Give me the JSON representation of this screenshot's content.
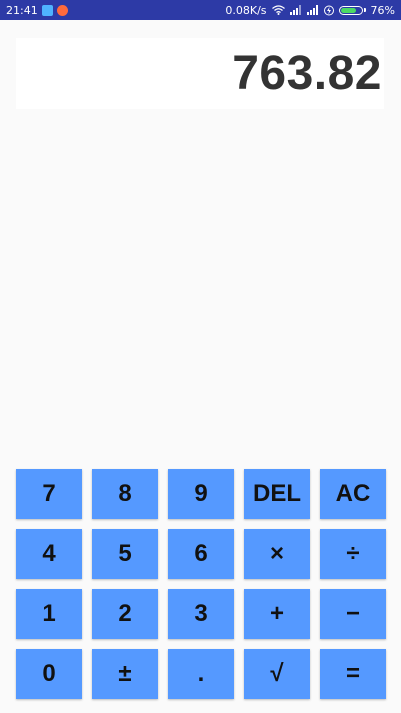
{
  "status_bar": {
    "time": "21:41",
    "network_speed": "0.08K/s",
    "battery_percent": "76%",
    "battery_level": 0.76,
    "icons": [
      "app-notification-icon",
      "app-notification-icon",
      "wifi-icon",
      "signal-icon",
      "signal-icon",
      "charging-icon",
      "battery-icon"
    ]
  },
  "display": {
    "value": "763.82"
  },
  "keypad": {
    "keys": [
      {
        "label": "7",
        "name": "key-7"
      },
      {
        "label": "8",
        "name": "key-8"
      },
      {
        "label": "9",
        "name": "key-9"
      },
      {
        "label": "DEL",
        "name": "key-delete"
      },
      {
        "label": "AC",
        "name": "key-all-clear"
      },
      {
        "label": "4",
        "name": "key-4"
      },
      {
        "label": "5",
        "name": "key-5"
      },
      {
        "label": "6",
        "name": "key-6"
      },
      {
        "label": "×",
        "name": "key-multiply"
      },
      {
        "label": "÷",
        "name": "key-divide"
      },
      {
        "label": "1",
        "name": "key-1"
      },
      {
        "label": "2",
        "name": "key-2"
      },
      {
        "label": "3",
        "name": "key-3"
      },
      {
        "label": "+",
        "name": "key-add"
      },
      {
        "label": "−",
        "name": "key-subtract"
      },
      {
        "label": "0",
        "name": "key-0"
      },
      {
        "label": "±",
        "name": "key-plus-minus"
      },
      {
        "label": ".",
        "name": "key-decimal"
      },
      {
        "label": "√",
        "name": "key-square-root"
      },
      {
        "label": "=",
        "name": "key-equals"
      }
    ]
  },
  "colors": {
    "status_bar": "#2d3aa6",
    "key_background": "#5599ff",
    "display_text": "#333333",
    "page_background": "#fafafa"
  }
}
